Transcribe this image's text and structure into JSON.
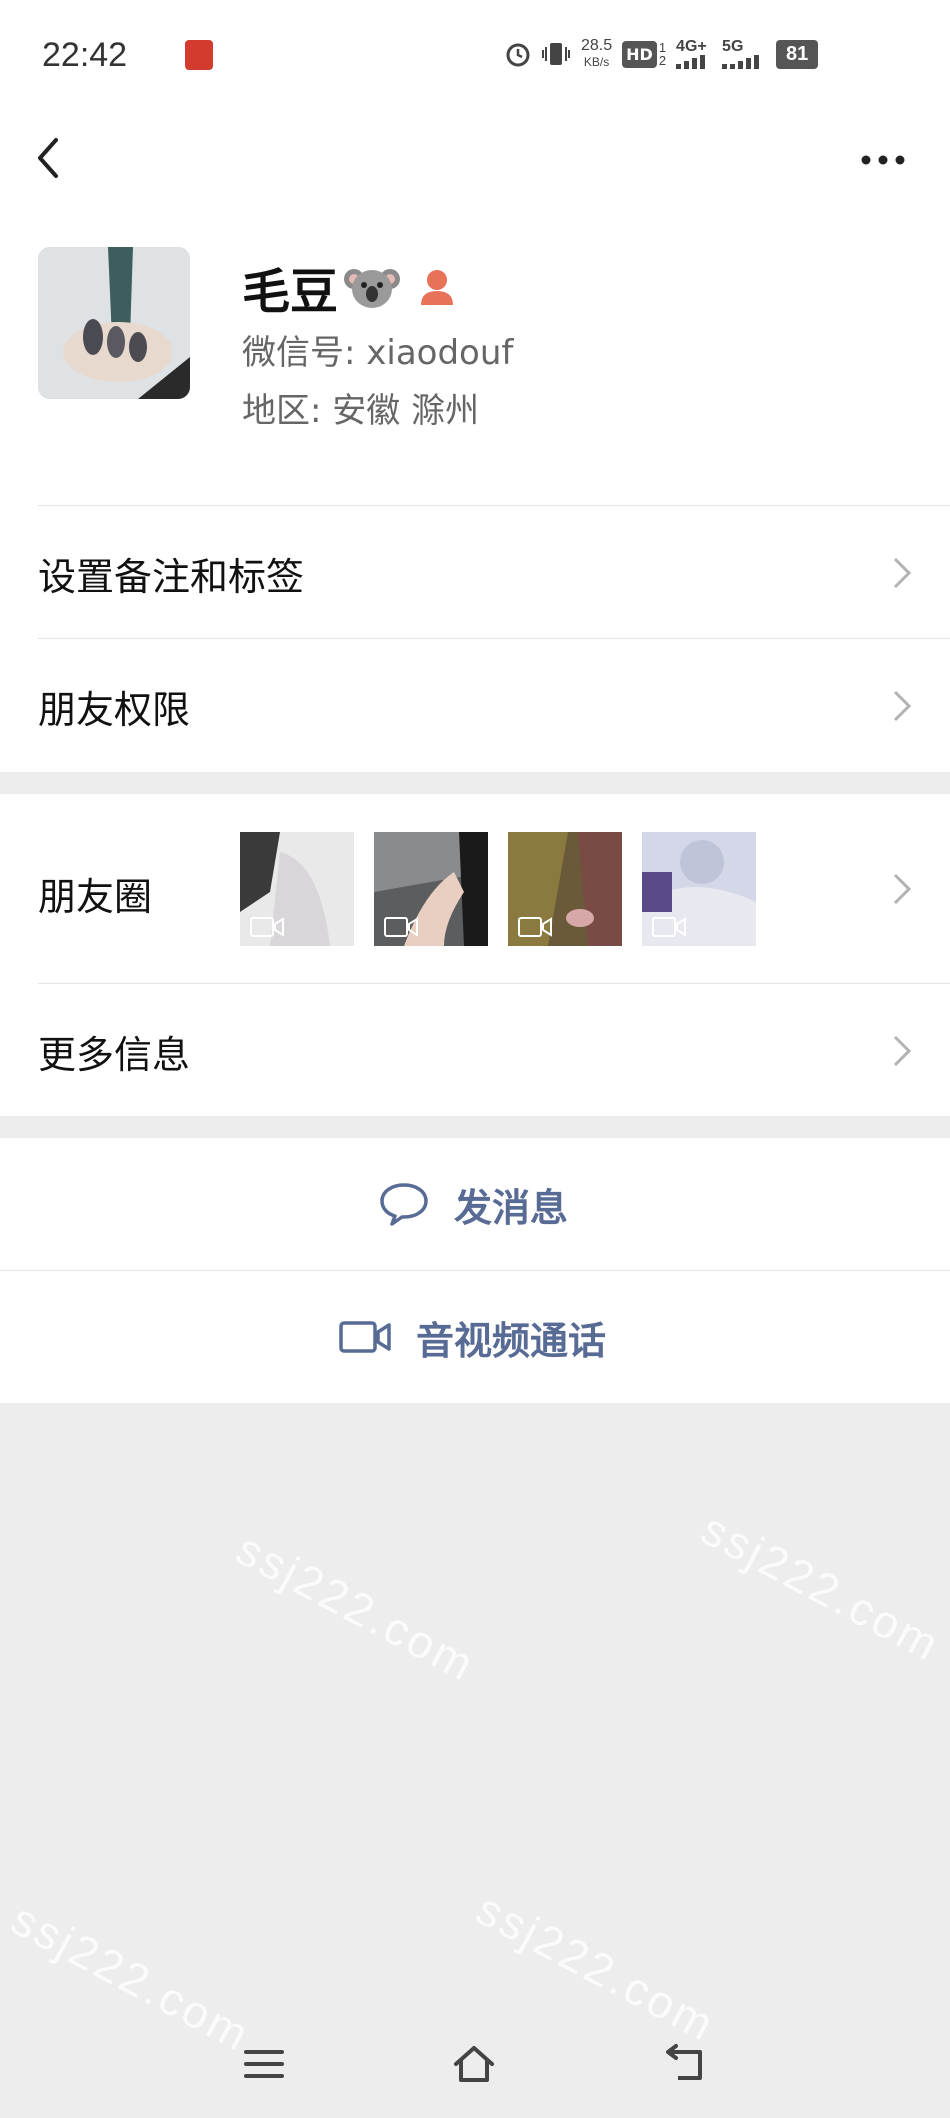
{
  "status_bar": {
    "time": "22:42",
    "net_speed_value": "28.5",
    "net_speed_unit": "KB/s",
    "hd_label": "HD",
    "hd_sub_top": "1",
    "hd_sub_bottom": "2",
    "net_4g": "4G+",
    "net_5g": "5G",
    "battery": "81"
  },
  "profile": {
    "name": "毛豆",
    "wechat_id": "微信号: xiaodouf",
    "region": "地区: 安徽  滁州"
  },
  "menu": {
    "remark_tags": "设置备注和标签",
    "friend_permissions": "朋友权限",
    "moments": "朋友圈",
    "more_info": "更多信息"
  },
  "actions": {
    "send_message": "发消息",
    "av_call": "音视频通话"
  },
  "watermark": "ssj222.com",
  "colors": {
    "accent_link": "#576b95",
    "page_bg": "#ededed",
    "status_app_icon": "#d23b2e",
    "person_icon": "#e8715a"
  }
}
